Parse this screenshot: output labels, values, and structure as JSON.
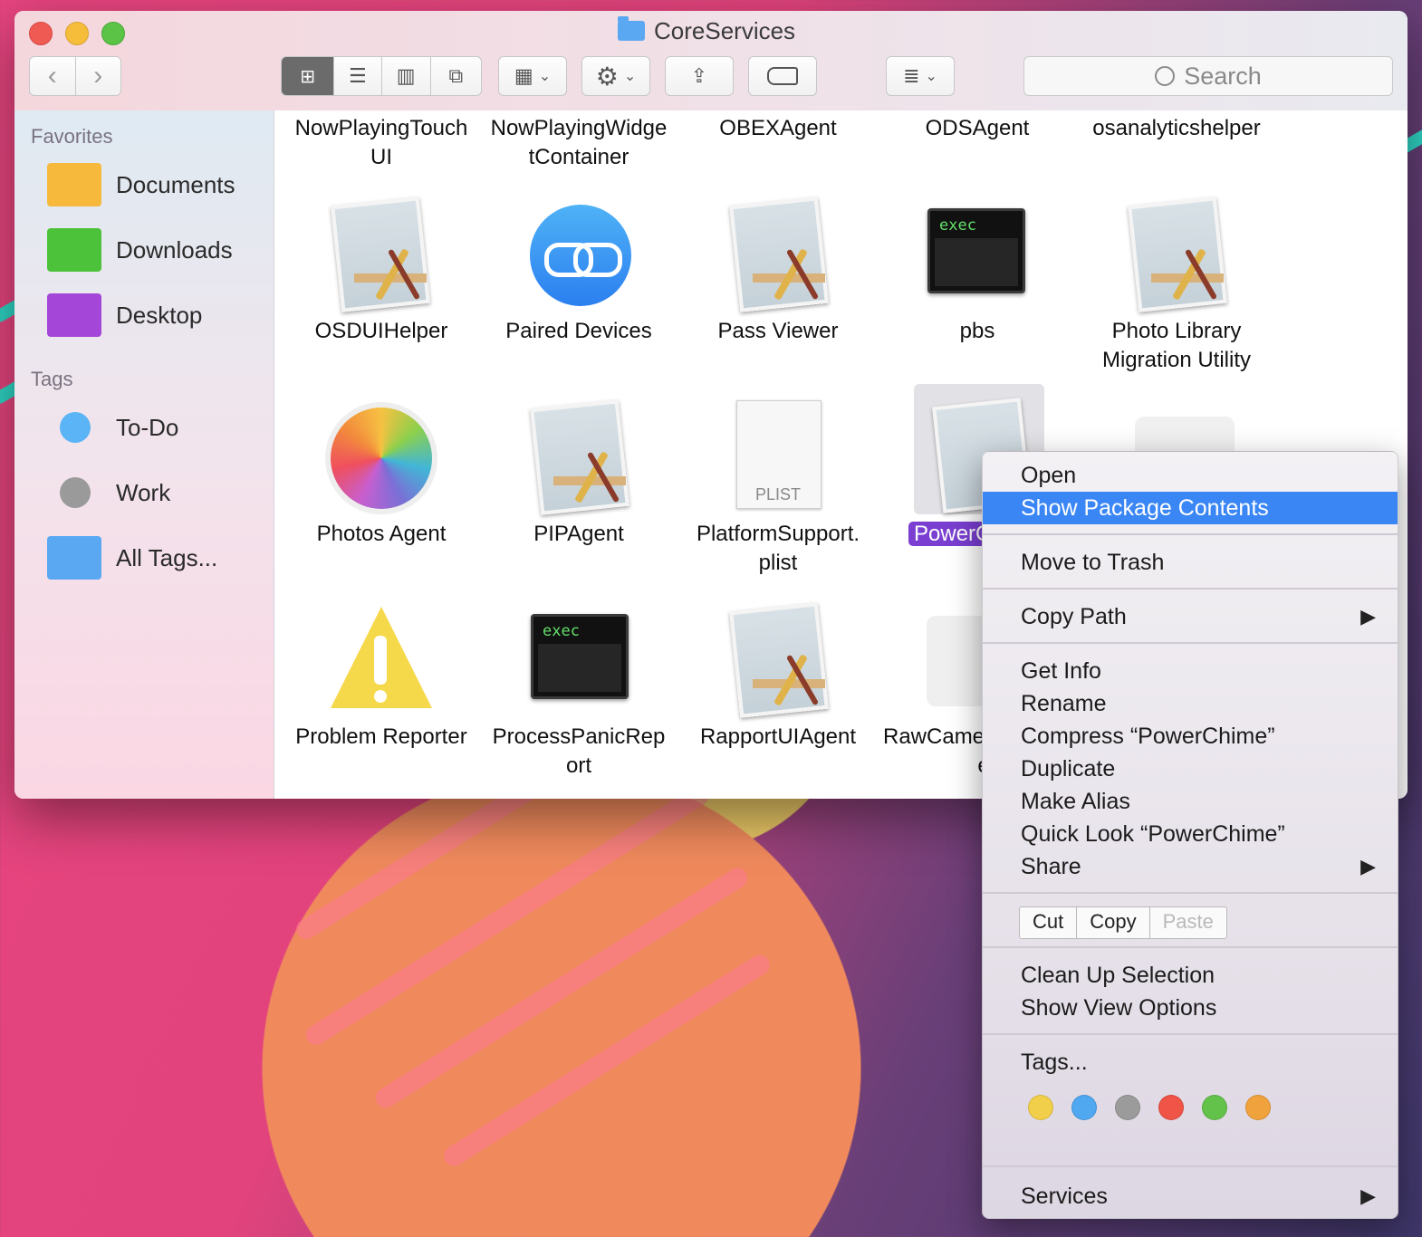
{
  "window": {
    "title": "CoreServices"
  },
  "toolbar": {
    "back_icon": "chevron-left-icon",
    "forward_icon": "chevron-right-icon",
    "search_placeholder": "Search"
  },
  "sidebar": {
    "favorites_header": "Favorites",
    "favorites": [
      {
        "label": "Documents",
        "color": "#f6b93b"
      },
      {
        "label": "Downloads",
        "color": "#4cc23a"
      },
      {
        "label": "Desktop",
        "color": "#a447d8"
      }
    ],
    "tags_header": "Tags",
    "tags": [
      {
        "label": "To-Do",
        "color": "#5ab4f5"
      },
      {
        "label": "Work",
        "color": "#9a9a9a"
      },
      {
        "label": "All Tags..."
      }
    ]
  },
  "files": {
    "row0": [
      "NowPlayingTouch UI",
      "NowPlayingWidge tContainer",
      "OBEXAgent",
      "ODSAgent",
      "osanalyticshelper"
    ],
    "row1": [
      "OSDUIHelper",
      "Paired Devices",
      "Pass Viewer",
      "pbs",
      "Photo Library Migration Utility"
    ],
    "row2": [
      "Photos Agent",
      "PIPAgent",
      "PlatformSupport. plist",
      "PowerC"
    ],
    "row3": [
      "Problem Reporter",
      "ProcessPanicRep ort",
      "RapportUIAgent",
      "RawCame",
      "e"
    ],
    "exec_text": "exec",
    "plist_text": "PLIST"
  },
  "context_menu": {
    "open": "Open",
    "show_package_contents": "Show Package Contents",
    "move_to_trash": "Move to Trash",
    "copy_path": "Copy Path",
    "get_info": "Get Info",
    "rename": "Rename",
    "compress": "Compress “PowerChime”",
    "duplicate": "Duplicate",
    "make_alias": "Make Alias",
    "quick_look": "Quick Look “PowerChime”",
    "share": "Share",
    "cut": "Cut",
    "copy": "Copy",
    "paste": "Paste",
    "clean_up": "Clean Up Selection",
    "show_view_options": "Show View Options",
    "tags": "Tags...",
    "services": "Services",
    "tag_colors": [
      "#f2cf4a",
      "#4fa8f0",
      "#9b9b9b",
      "#ef5446",
      "#63c24a",
      "#f0a23c"
    ]
  }
}
